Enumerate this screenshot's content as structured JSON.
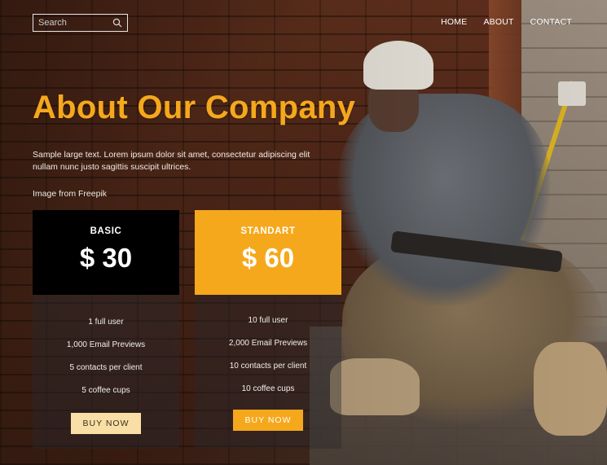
{
  "header": {
    "search": {
      "placeholder": "Search",
      "value": ""
    },
    "nav": [
      {
        "label": "HOME"
      },
      {
        "label": "ABOUT"
      },
      {
        "label": "CONTACT"
      }
    ]
  },
  "hero": {
    "title": "About Our Company",
    "description": "Sample large text. Lorem ipsum dolor sit amet, consectetur adipiscing elit nullam nunc justo sagittis suscipit ultrices.",
    "credit": "Image from Freepik"
  },
  "plans": [
    {
      "name": "BASIC",
      "price": "$ 30",
      "features": [
        "1 full user",
        "1,000 Email Previews",
        "5 contacts per client",
        "5 coffee cups"
      ],
      "button": "BUY NOW",
      "color": "#000000"
    },
    {
      "name": "STANDART",
      "price": "$ 60",
      "features": [
        "10 full user",
        "2,000 Email Previews",
        "10 contacts per client",
        "10 coffee cups"
      ],
      "button": "BUY NOW",
      "color": "#f5a81c"
    }
  ],
  "icons": {
    "search": "search-icon"
  },
  "colors": {
    "accent": "#f5a81c",
    "button_light": "#f9dfa6"
  }
}
